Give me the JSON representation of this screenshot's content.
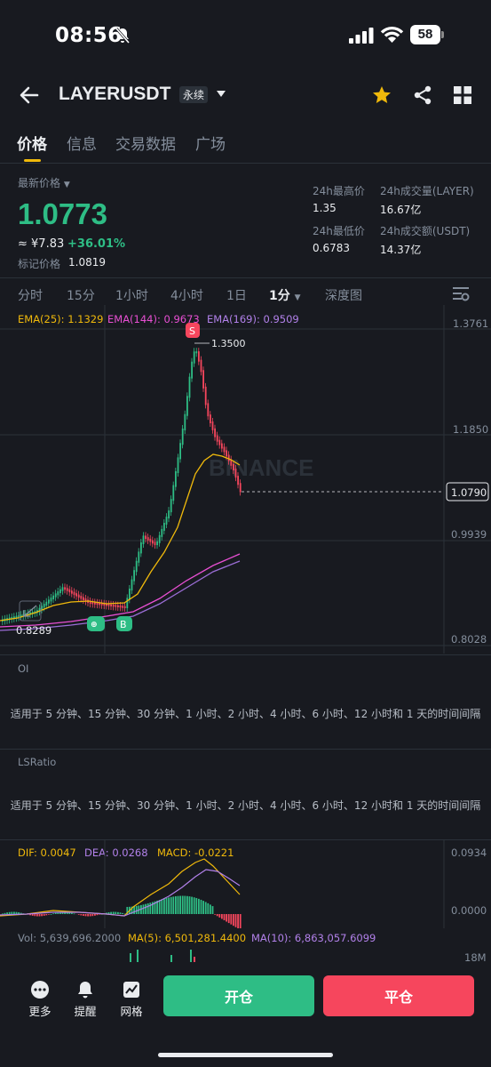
{
  "status": {
    "time": "08:56",
    "battery": "58"
  },
  "header": {
    "symbol": "LAYERUSDT",
    "badge": "永续"
  },
  "tabs": [
    "价格",
    "信息",
    "交易数据",
    "广场"
  ],
  "price_panel": {
    "label": "最新价格",
    "price": "1.0773",
    "cny": "≈ ¥7.83",
    "change": "+36.01%",
    "mark_label": "标记价格",
    "mark_value": "1.0819",
    "high_label": "24h最高价",
    "high_value": "1.35",
    "low_label": "24h最低价",
    "low_value": "0.6783",
    "vol_label": "24h成交量(LAYER)",
    "vol_value": "16.67亿",
    "amt_label": "24h成交额(USDT)",
    "amt_value": "14.37亿"
  },
  "intervals": [
    "分时",
    "15分",
    "1小时",
    "4小时",
    "1日",
    "1分",
    "深度图"
  ],
  "active_interval": "1分",
  "main_chart": {
    "ema25": "EMA(25): 1.1329",
    "ema144": "EMA(144): 0.9673",
    "ema169": "EMA(169): 0.9509",
    "y_labels": [
      "1.3761",
      "1.1850",
      "0.9939",
      "0.8028"
    ],
    "high_marker": "1.3500",
    "low_marker": "0.8289",
    "last_price_tag": "1.0790",
    "watermark": "BINANCE",
    "signal_s": "S",
    "signal_b": "B"
  },
  "oi": {
    "title": "OI",
    "note": "适用于 5 分钟、15 分钟、30 分钟、1 小时、2 小时、4 小时、6 小时、12 小时和 1 天的时间间隔"
  },
  "lsratio": {
    "title": "LSRatio",
    "note": "适用于 5 分钟、15 分钟、30 分钟、1 小时、2 小时、4 小时、6 小时、12 小时和 1 天的时间间隔"
  },
  "macd": {
    "dif": "DIF: 0.0047",
    "dea": "DEA: 0.0268",
    "macd": "MACD: -0.0221",
    "y_top": "0.0934",
    "y_zero": "0.0000"
  },
  "volume": {
    "vol": "Vol: 5,639,696.2000",
    "ma5": "MA(5): 6,501,281.4400",
    "ma10": "MA(10): 6,863,057.6099",
    "y_label": "18M"
  },
  "bottom_bar": {
    "more": "更多",
    "alert": "提醒",
    "grid": "网格",
    "open": "开仓",
    "close": "平仓"
  },
  "colors": {
    "up": "#2ebd85",
    "down": "#f6465d",
    "accent": "#f0b90b",
    "bg": "#181a20"
  }
}
